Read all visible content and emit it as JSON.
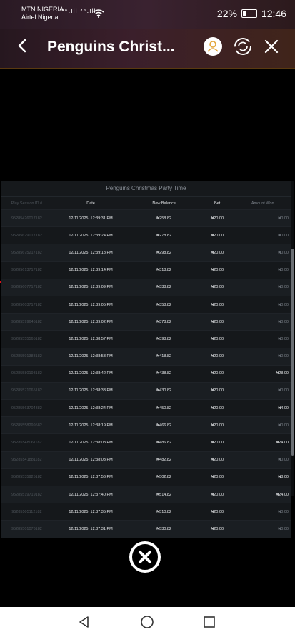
{
  "status_bar": {
    "carrier1": "MTN NIGERIA",
    "carrier2": "Airtel Nigeria",
    "signal_text": "⁴⁶.ıll ⁴⁶.ıll",
    "battery_percent": "22%",
    "battery_level": 0.22,
    "time": "12:46"
  },
  "app_bar": {
    "back_icon": "back-arrow-icon",
    "title": "Penguins Christ...",
    "user_icon": "user-icon",
    "refresh_icon": "refresh-icon",
    "close_icon": "close-icon",
    "accent": "#e3a63a"
  },
  "history": {
    "title": "Penguins Christmas Party Time",
    "columns": [
      "Play Session ID #",
      "Date",
      "New Balance",
      "Bet",
      "Amount Won"
    ],
    "rows": [
      {
        "id": "95285426017182",
        "date": "12/11/2025, 12:39:31 PM",
        "balance": "₦258.82",
        "bet": "₦20.00",
        "won": "₦0.00"
      },
      {
        "id": "95285629017182",
        "date": "12/11/2025, 12:39:24 PM",
        "balance": "₦278.82",
        "bet": "₦20.00",
        "won": "₦0.00"
      },
      {
        "id": "95285675217182",
        "date": "12/11/2025, 12:39:18 PM",
        "balance": "₦298.82",
        "bet": "₦20.00",
        "won": "₦0.00"
      },
      {
        "id": "95285613717182",
        "date": "12/11/2025, 12:39:14 PM",
        "balance": "₦318.82",
        "bet": "₦20.00",
        "won": "₦0.00"
      },
      {
        "id": "95285607717182",
        "date": "12/11/2025, 12:39:09 PM",
        "balance": "₦338.82",
        "bet": "₦20.00",
        "won": "₦0.00"
      },
      {
        "id": "95285603717182",
        "date": "12/11/2025, 12:39:05 PM",
        "balance": "₦358.82",
        "bet": "₦20.00",
        "won": "₦0.00"
      },
      {
        "id": "95285599645182",
        "date": "12/11/2025, 12:39:02 PM",
        "balance": "₦378.82",
        "bet": "₦20.00",
        "won": "₦0.00"
      },
      {
        "id": "95285555565182",
        "date": "12/11/2025, 12:38:57 PM",
        "balance": "₦398.82",
        "bet": "₦20.00",
        "won": "₦0.00"
      },
      {
        "id": "95285591383182",
        "date": "12/11/2025, 12:38:53 PM",
        "balance": "₦418.82",
        "bet": "₦20.00",
        "won": "₦0.00"
      },
      {
        "id": "95285580193182",
        "date": "12/11/2025, 12:38:42 PM",
        "balance": "₦438.82",
        "bet": "₦20.00",
        "won": "₦28.00"
      },
      {
        "id": "95285571065182",
        "date": "12/11/2025, 12:38:33 PM",
        "balance": "₦430.82",
        "bet": "₦20.00",
        "won": "₦0.00"
      },
      {
        "id": "95285563704382",
        "date": "12/11/2025, 12:38:24 PM",
        "balance": "₦450.82",
        "bet": "₦20.00",
        "won": "₦4.00"
      },
      {
        "id": "95285558299582",
        "date": "12/11/2025, 12:38:19 PM",
        "balance": "₦466.82",
        "bet": "₦20.00",
        "won": "₦0.00"
      },
      {
        "id": "95285548061182",
        "date": "12/11/2025, 12:38:08 PM",
        "balance": "₦486.82",
        "bet": "₦20.00",
        "won": "₦24.00"
      },
      {
        "id": "95285541881182",
        "date": "12/11/2025, 12:38:03 PM",
        "balance": "₦482.82",
        "bet": "₦20.00",
        "won": "₦0.00"
      },
      {
        "id": "95285535925182",
        "date": "12/11/2025, 12:37:56 PM",
        "balance": "₦502.82",
        "bet": "₦20.00",
        "won": "₦8.00"
      },
      {
        "id": "95285519719182",
        "date": "12/11/2025, 12:37:40 PM",
        "balance": "₦514.82",
        "bet": "₦20.00",
        "won": "₦24.00"
      },
      {
        "id": "95285505112182",
        "date": "12/11/2025, 12:37:35 PM",
        "balance": "₦510.82",
        "bet": "₦20.00",
        "won": "₦0.00"
      },
      {
        "id": "95285501076182",
        "date": "12/11/2025, 12:37:31 PM",
        "balance": "₦530.82",
        "bet": "₦20.00",
        "won": "₦0.00"
      }
    ]
  },
  "footer": {
    "close_icon": "close-circle-icon"
  },
  "nav": {
    "back_icon": "nav-back-icon",
    "home_icon": "nav-home-icon",
    "recents_icon": "nav-recents-icon"
  }
}
